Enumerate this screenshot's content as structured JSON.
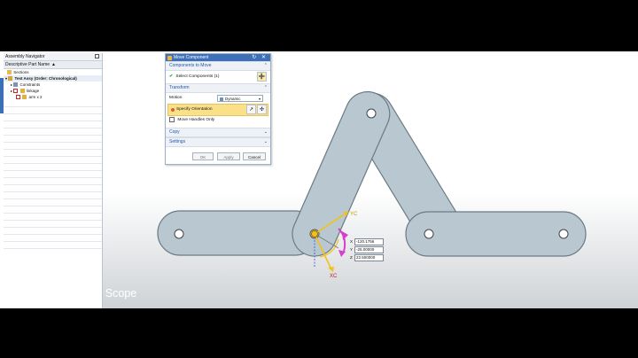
{
  "navigator": {
    "title": "Assembly Navigator",
    "column_header": "Descriptive Part Name",
    "sort_glyph": "▲",
    "items": [
      {
        "label": "Sections"
      },
      {
        "label": "Test Assy (Order: Chronological)"
      },
      {
        "label": "Constraints"
      },
      {
        "label": "linkage"
      },
      {
        "label": "arm x 2"
      }
    ]
  },
  "dialog": {
    "title": "Move Component",
    "title_buttons": "↻ ✕",
    "sections": {
      "components_to_move": "Components to Move",
      "transform": "Transform",
      "copy": "Copy",
      "settings": "Settings"
    },
    "select_components": "Select Components (1)",
    "motion_label": "Motion",
    "motion_value": "Dynamic",
    "specify_orientation": "Specify Orientation",
    "move_handles_only": "Move Handles Only",
    "buttons": {
      "ok": "OK",
      "apply": "Apply",
      "cancel": "Cancel"
    }
  },
  "viewport": {
    "axis_labels": {
      "yc": "YC",
      "xc": "XC"
    },
    "coords": [
      {
        "axis": "X",
        "value": "-120.1756"
      },
      {
        "axis": "Y",
        "value": "-25.00000"
      },
      {
        "axis": "Z",
        "value": "22.500000"
      }
    ],
    "colors": {
      "link_fill": "#b9c8d0",
      "link_stroke": "#6b7a84",
      "handle_yellow": "#f2c21b",
      "handle_magenta": "#d640c8"
    }
  },
  "caption": "Move Component - Scope"
}
